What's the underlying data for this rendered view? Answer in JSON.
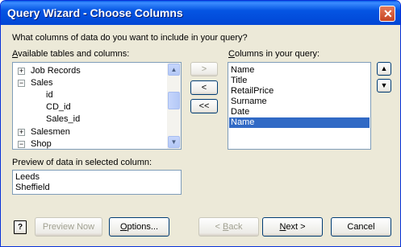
{
  "window": {
    "title": "Query Wizard - Choose Columns",
    "close_glyph": "✕"
  },
  "prompt": "What columns of data do you want to include in your query?",
  "available": {
    "label_prefix": "A",
    "label_rest": "vailable tables and columns:",
    "items": [
      {
        "label": "Job Records",
        "expander": "+"
      },
      {
        "label": "Sales",
        "expander": "−"
      },
      {
        "label": "id"
      },
      {
        "label": "CD_id"
      },
      {
        "label": "Sales_id"
      },
      {
        "label": "Salesmen",
        "expander": "+"
      },
      {
        "label": "Shop",
        "expander": "−"
      }
    ]
  },
  "move_buttons": {
    "add": ">",
    "remove": "<",
    "remove_all": "<<"
  },
  "query_columns": {
    "label_prefix": "C",
    "label_rest": "olumns in your query:",
    "items": [
      "Name",
      "Title",
      "RetailPrice",
      "Surname",
      "Date",
      "Name"
    ],
    "selected_index": 5
  },
  "order_buttons": {
    "up": "▲",
    "down": "▼"
  },
  "preview": {
    "label": "Preview of data in selected column:",
    "values": [
      "Leeds",
      "Sheffield"
    ]
  },
  "footer": {
    "help": "?",
    "preview_now": "Preview Now",
    "options_prefix": "O",
    "options_rest": "ptions...",
    "back_prefix": "< ",
    "back_mn": "B",
    "back_rest": "ack",
    "next_mn": "N",
    "next_rest": "ext >",
    "cancel": "Cancel"
  }
}
